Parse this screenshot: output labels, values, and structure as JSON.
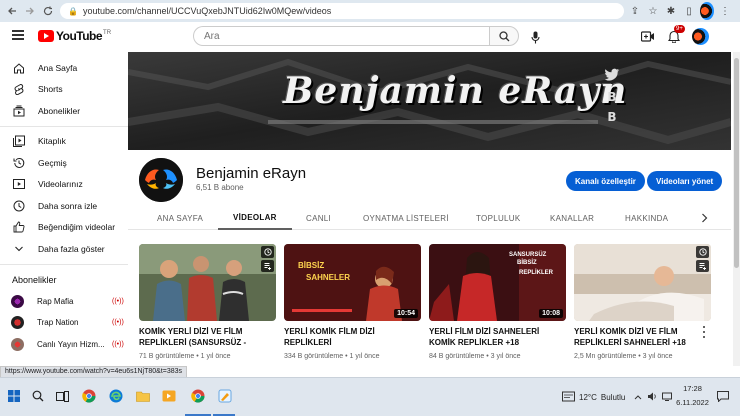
{
  "browser": {
    "url": "youtube.com/channel/UCCVuQxebJNTUid62Iw0MQew/videos"
  },
  "topbar": {
    "logo_text": "YouTube",
    "logo_region": "TR",
    "search_placeholder": "Ara",
    "notification_count": "9+"
  },
  "sidebar": {
    "items": [
      {
        "label": "Ana Sayfa",
        "icon": "home-icon"
      },
      {
        "label": "Shorts",
        "icon": "shorts-icon"
      },
      {
        "label": "Abonelikler",
        "icon": "subscriptions-icon"
      },
      {
        "label": "Kitaplık",
        "icon": "library-icon"
      },
      {
        "label": "Geçmiş",
        "icon": "history-icon"
      },
      {
        "label": "Videolarınız",
        "icon": "your-videos-icon"
      },
      {
        "label": "Daha sonra izle",
        "icon": "watch-later-icon"
      },
      {
        "label": "Beğendiğim videolar",
        "icon": "liked-icon"
      },
      {
        "label": "Daha fazla göster",
        "icon": "chevron-down-icon"
      }
    ],
    "subscriptions_heading": "Abonelikler",
    "subscriptions": [
      {
        "name": "Rap Mafia",
        "live": "((•))"
      },
      {
        "name": "Trap Nation",
        "live": "((•))"
      },
      {
        "name": "Canlı Yayın Hizm...",
        "live": "((•))"
      }
    ]
  },
  "banner": {
    "title": "Benjamin eRayn"
  },
  "channel": {
    "name": "Benjamin eRayn",
    "subscribers": "6,51 B abone",
    "customize_label": "Kanalı özelleştir",
    "manage_label": "Videoları yönet"
  },
  "tabs": [
    "ANA SAYFA",
    "VİDEOLAR",
    "CANLI",
    "OYNATMA LİSTELERİ",
    "TOPLULUK",
    "KANALLAR",
    "HAKKINDA"
  ],
  "videos": [
    {
      "title": "KOMİK YERLİ DİZİ VE FİLM REPLİKLERİ (SANSURSÜZ - BİBSİZ)",
      "views": "71 B görüntüleme",
      "age": "1 yıl önce",
      "duration": ""
    },
    {
      "title": "YERLİ KOMİK FİLM DİZİ REPLİKLERİ",
      "views": "334 B görüntüleme",
      "age": "1 yıl önce",
      "duration": "10:54",
      "thumb_text_1": "BİBSİZ",
      "thumb_text_2": "SAHNELER"
    },
    {
      "title": "YERLİ FİLM DİZİ SAHNELERİ KOMİK REPLİKLER +18",
      "views": "84 B görüntüleme",
      "age": "3 yıl önce",
      "duration": "10:08",
      "thumb_text_1": "SANSURSÜZ",
      "thumb_text_2": "BİBSİZ",
      "thumb_text_3": "REPLİKLER"
    },
    {
      "title": "YERLİ KOMİK DİZİ VE FİLM REPLİKLERİ SAHNELERİ +18",
      "views": "2,5 Mn görüntüleme",
      "age": "3 yıl önce",
      "duration": ""
    }
  ],
  "status_url": "https://www.youtube.com/watch?v=4eu6s1NjT80&t=383s",
  "taskbar": {
    "temperature": "12°C",
    "weather": "Bulutlu",
    "time": "17:28",
    "date": "6.11.2022"
  }
}
